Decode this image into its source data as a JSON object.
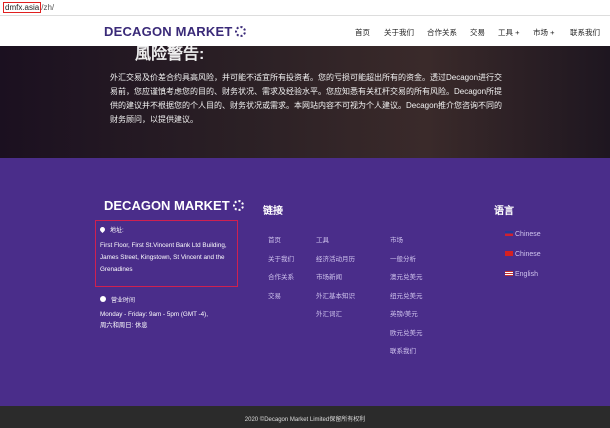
{
  "browser": {
    "url_host": "dmfx.asia",
    "url_path": "/zh/"
  },
  "header": {
    "logo_text": "DECAGON MARKET",
    "nav": [
      "首页",
      "关于我们",
      "合作关系",
      "交易",
      "工具 +",
      "市场 +",
      "联系我们"
    ]
  },
  "hero": {
    "title": "風险警告:",
    "text": "外汇交易及价差合约具高风险，并可能不适宜所有投资者。您的亏损可能超出所有的资金。透过Decagon进行交易前，您应谨慎考虑您的目的、财务状况、需求及经验水平。您应知悉有关杠杆交易的所有风险。Decagon所提供的建议并不根据您的个人目的、财务状况或需求。本网站内容不可视为个人建议。Decagon推介您咨询不同的财务顾问，以提供建议。"
  },
  "footer": {
    "logo_text": "DECAGON MARKET",
    "address_label": "地址:",
    "address": "First Floor, First St.Vincent Bank Ltd Building, James Street, Kingstown, St Vincent and the Grenadines",
    "hours_label": "营业时间",
    "hours_line1": "Monday - Friday: 9am - 5pm (GMT -4),",
    "hours_line2": "周六和周日: 休息",
    "links_title": "链接",
    "links_col1": [
      "首页",
      "关于我们",
      "合作关系",
      "交易"
    ],
    "links_col2": [
      "工具",
      "经济活动月历",
      "市场新闻",
      "外汇基本知识",
      "外汇词汇"
    ],
    "links_col3": [
      "市场",
      "一般分析",
      "澳元兑美元",
      "纽元兑美元",
      "英镑/美元",
      "欧元兑美元",
      "联系我们"
    ],
    "lang_title": "语言",
    "languages": [
      "Chinese",
      "Chinese",
      "English"
    ]
  },
  "copyright": "2020 ©Decagon Market Limited保留所有权利"
}
